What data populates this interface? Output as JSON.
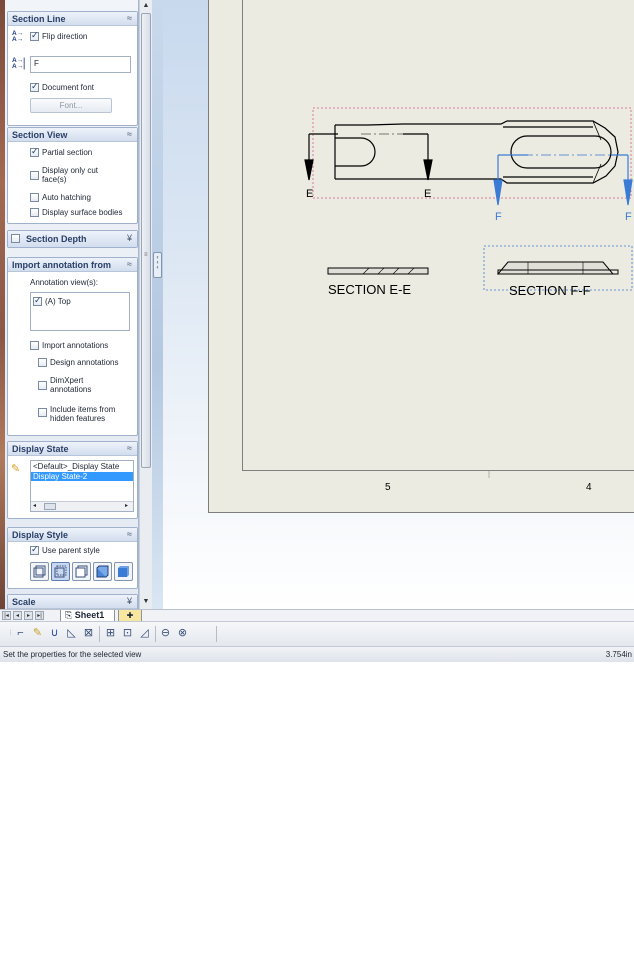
{
  "panel": {
    "section_line": {
      "title": "Section Line",
      "flip_direction": {
        "label": "Flip direction",
        "checked": true
      },
      "label_value": "F",
      "document_font": {
        "label": "Document font",
        "checked": true
      },
      "font_button": "Font..."
    },
    "section_view": {
      "title": "Section View",
      "options": [
        {
          "label": "Partial section",
          "checked": true
        },
        {
          "label": "Display only cut face(s)",
          "checked": false
        },
        {
          "label": "Auto hatching",
          "checked": false
        },
        {
          "label": "Display surface bodies",
          "checked": false
        }
      ]
    },
    "section_depth": {
      "title": "Section Depth",
      "checked": false
    },
    "import_annotation": {
      "title": "Import annotation from",
      "views_label": "Annotation view(s):",
      "views": [
        {
          "label": "(A) Top",
          "checked": true
        }
      ],
      "import_annotations": {
        "label": "Import annotations",
        "checked": false
      },
      "design_annotations": {
        "label": "Design annotations",
        "checked": false
      },
      "dimxpert_annotations": {
        "label": "DimXpert annotations",
        "checked": false
      },
      "hidden_features": {
        "label": "Include items from hidden features",
        "checked": false
      }
    },
    "display_state": {
      "title": "Display State",
      "items": [
        "<Default>_Display State",
        "Display State-2"
      ],
      "selected_index": 1
    },
    "display_style": {
      "title": "Display Style",
      "use_parent": {
        "label": "Use parent style",
        "checked": true
      },
      "style_icons": [
        "wireframe-icon",
        "hidden-lines-visible-icon",
        "hidden-lines-removed-icon",
        "shaded-with-edges-icon",
        "shaded-icon"
      ]
    },
    "scale": {
      "title": "Scale"
    }
  },
  "drawing": {
    "section_ee_label": "SECTION E-E",
    "section_ff_label": "SECTION F-F",
    "section_line_e_label": "E",
    "section_line_f_label": "F",
    "zone_labels": [
      "5",
      "4"
    ]
  },
  "tabs": {
    "sheet_name": "Sheet1"
  },
  "status": {
    "message": "Set the properties for the selected view",
    "value": "3.754in"
  },
  "colors": {
    "accent": "#3a7bd5",
    "selection": "#3399ff",
    "sheet": "#ecebe1"
  }
}
